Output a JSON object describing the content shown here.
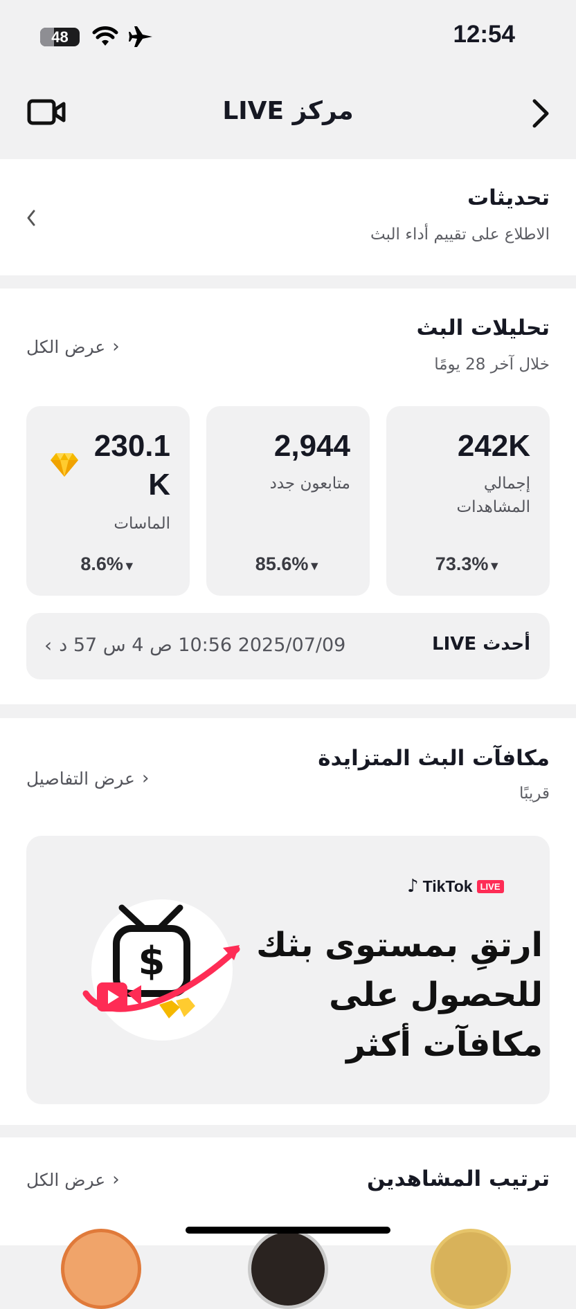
{
  "status_bar": {
    "time": "12:54",
    "battery": "48",
    "icons": [
      "wifi-icon",
      "airplane-mode-icon"
    ]
  },
  "header": {
    "title": "مركز LIVE",
    "left_icon": "video-camera-icon",
    "right_icon": "chevron-right-icon"
  },
  "updates": {
    "title": "تحديثات",
    "subtitle": "الاطلاع على تقييم أداء البث"
  },
  "analytics": {
    "title": "تحليلات البث",
    "subtitle": "خلال آخر 28 يومًا",
    "view_all": "عرض الكل",
    "stats": [
      {
        "value": "242K",
        "label_line1": "إجمالي",
        "label_line2": "المشاهدات",
        "change": "73.3%"
      },
      {
        "value": "2,944",
        "label_line1": "متابعون جدد",
        "label_line2": "",
        "change": "85.6%"
      },
      {
        "value_line1": "230.1",
        "value_line2": "K",
        "label_line1": "الماسات",
        "label_line2": "",
        "change": "8.6%",
        "icon": "diamond-icon"
      }
    ],
    "latest_live": {
      "label": "أحدث LIVE",
      "value": "2025/07/09 10:56 ص 4 س 57 د"
    }
  },
  "rewards": {
    "title": "مكافآت البث المتزايدة",
    "subtitle": "قريبًا",
    "details": "عرض التفاصيل",
    "banner": {
      "brand": "TikTok",
      "brand_badge": "LIVE",
      "line1": "ارتقِ بمستوى بثك",
      "line2": "للحصول على",
      "line3": "مكافآت أكثر"
    }
  },
  "ranking": {
    "title": "ترتيب المشاهدين",
    "view_all": "عرض الكل"
  },
  "colors": {
    "accent": "#fe2c55",
    "diamond": "#f5b800",
    "background": "#f1f1f2"
  }
}
